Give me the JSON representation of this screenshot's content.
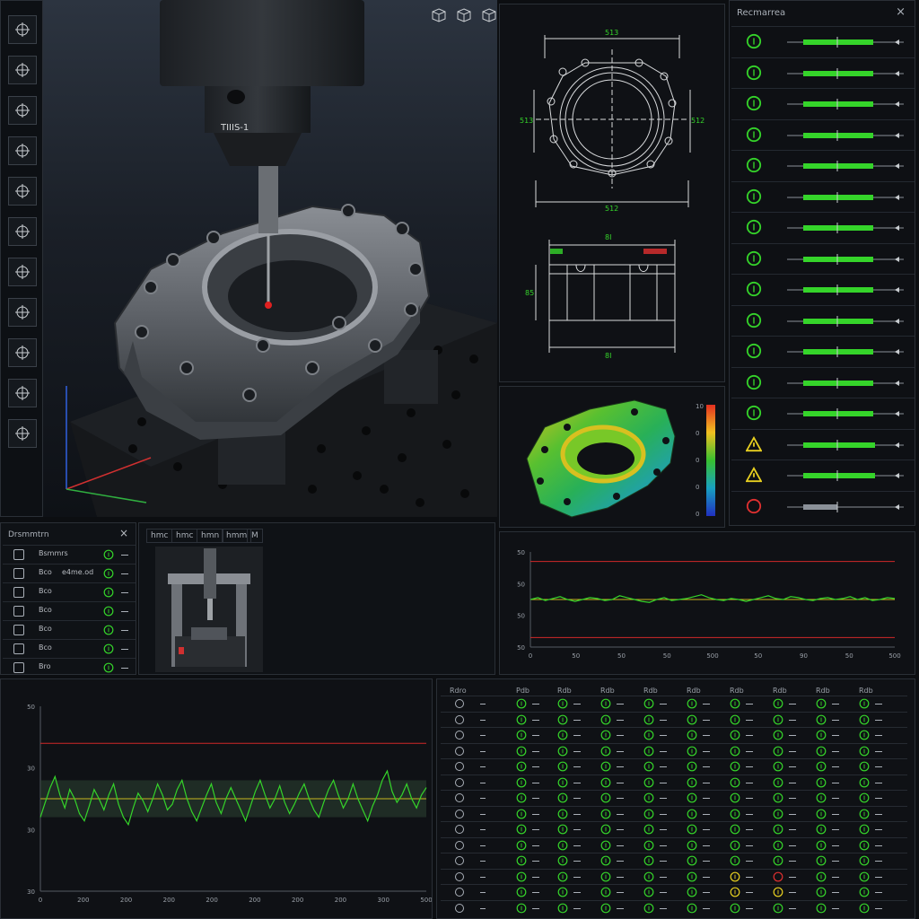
{
  "toolbar": {
    "tools": [
      "3d-cube-icon",
      "crosshair-icon",
      "circle-crosshair-icon",
      "angle-icon",
      "axis-measure-icon",
      "cylinder-icon",
      "plane-icon",
      "distance-icon",
      "probe-icon",
      "point-icon",
      "settings-circle-icon"
    ]
  },
  "viewport": {
    "probe_label": "TIIIS-1",
    "view_cubes": [
      "view-cube-front-icon",
      "view-cube-side-icon",
      "view-cube-top-icon"
    ]
  },
  "drawing": {
    "dims": [
      "513",
      "512",
      "513",
      "512"
    ],
    "side_dims": [
      "8I",
      "8I",
      "85"
    ]
  },
  "heatmap": {
    "scale_ticks": [
      "10",
      "0",
      "0",
      "0",
      "0"
    ],
    "colors": [
      "#e53020",
      "#f0c020",
      "#38c030",
      "#18a0c0",
      "#2030c0"
    ]
  },
  "results": {
    "title": "Recmarrea",
    "close": "×",
    "rows": [
      {
        "status": "ok"
      },
      {
        "status": "ok"
      },
      {
        "status": "ok"
      },
      {
        "status": "ok"
      },
      {
        "status": "ok"
      },
      {
        "status": "ok"
      },
      {
        "status": "ok"
      },
      {
        "status": "ok"
      },
      {
        "status": "ok"
      },
      {
        "status": "ok"
      },
      {
        "status": "ok"
      },
      {
        "status": "ok"
      },
      {
        "status": "ok"
      },
      {
        "status": "warn"
      },
      {
        "status": "warn"
      },
      {
        "status": "fail"
      }
    ],
    "colors": {
      "ok": "#35d42a",
      "warn": "#e8d020",
      "fail": "#e03030"
    }
  },
  "plist": {
    "title": "Drsmmtrn",
    "close": "×",
    "rows": [
      {
        "name": "Bsmmrs",
        "value": ""
      },
      {
        "name": "Bco",
        "value": "e4me.od"
      },
      {
        "name": "Bco",
        "value": ""
      },
      {
        "name": "Bco",
        "value": ""
      },
      {
        "name": "Bco",
        "value": ""
      },
      {
        "name": "Bco",
        "value": ""
      },
      {
        "name": "Bro",
        "value": ""
      }
    ]
  },
  "machine": {
    "tools": [
      "hmc",
      "hmc",
      "hmn",
      "hmm",
      "M"
    ]
  },
  "chart_small": {
    "yticks": [
      "50",
      "50",
      "50",
      "50"
    ],
    "xticks": [
      "0",
      "50",
      "50",
      "50",
      "500",
      "50",
      "90",
      "50",
      "500"
    ]
  },
  "chart_big": {
    "yticks": [
      "50",
      "30",
      "30",
      "30"
    ],
    "xticks": [
      "0",
      "200",
      "200",
      "200",
      "200",
      "200",
      "200",
      "200",
      "300",
      "500"
    ]
  },
  "table": {
    "headers": [
      "Rdro",
      "Pdb",
      "Rdb",
      "Rdb",
      "Rdb",
      "Rdb",
      "Rdb",
      "Rdb",
      "Rdb",
      "Rdb"
    ],
    "rows": 14
  },
  "chart_data": [
    {
      "type": "line",
      "title": "",
      "xlabel": "",
      "ylabel": "",
      "yticks": [
        "50",
        "50",
        "50",
        "50"
      ],
      "xticks": [
        "0",
        "50",
        "50",
        "50",
        "500",
        "50",
        "90",
        "50",
        "500"
      ],
      "upper_limit": 0.9,
      "lower_limit": 0.1,
      "nominal": 0.5,
      "series": [
        {
          "color": "#35d42a",
          "values": [
            0.5,
            0.52,
            0.49,
            0.51,
            0.53,
            0.5,
            0.48,
            0.5,
            0.52,
            0.51,
            0.49,
            0.5,
            0.54,
            0.52,
            0.5,
            0.48,
            0.47,
            0.5,
            0.52,
            0.49,
            0.5,
            0.51,
            0.53,
            0.55,
            0.52,
            0.5,
            0.49,
            0.51,
            0.5,
            0.48,
            0.5,
            0.52,
            0.54,
            0.51,
            0.5,
            0.53,
            0.52,
            0.5,
            0.49,
            0.51,
            0.52,
            0.5,
            0.51,
            0.53,
            0.5,
            0.52,
            0.49,
            0.5,
            0.52,
            0.51
          ]
        }
      ]
    },
    {
      "type": "line",
      "title": "",
      "xlabel": "",
      "ylabel": "",
      "yticks": [
        "50",
        "30",
        "30",
        "30"
      ],
      "xticks": [
        "0",
        "200",
        "200",
        "200",
        "200",
        "200",
        "200",
        "200",
        "300",
        "500"
      ],
      "upper_limit": 0.8,
      "band": [
        0.4,
        0.6
      ],
      "nominal": 0.5,
      "series": [
        {
          "color": "#35d42a",
          "values": [
            0.4,
            0.48,
            0.56,
            0.62,
            0.52,
            0.45,
            0.55,
            0.5,
            0.42,
            0.38,
            0.46,
            0.55,
            0.5,
            0.44,
            0.52,
            0.58,
            0.47,
            0.4,
            0.36,
            0.45,
            0.53,
            0.49,
            0.43,
            0.5,
            0.58,
            0.52,
            0.44,
            0.47,
            0.55,
            0.6,
            0.5,
            0.43,
            0.38,
            0.45,
            0.52,
            0.58,
            0.48,
            0.42,
            0.5,
            0.56,
            0.5,
            0.44,
            0.38,
            0.46,
            0.54,
            0.6,
            0.52,
            0.45,
            0.5,
            0.57,
            0.48,
            0.42,
            0.47,
            0.53,
            0.58,
            0.5,
            0.44,
            0.4,
            0.48,
            0.55,
            0.6,
            0.52,
            0.45,
            0.5,
            0.58,
            0.5,
            0.44,
            0.38,
            0.46,
            0.52,
            0.6,
            0.65,
            0.54,
            0.48,
            0.52,
            0.58,
            0.5,
            0.45,
            0.52,
            0.56
          ]
        }
      ]
    }
  ]
}
